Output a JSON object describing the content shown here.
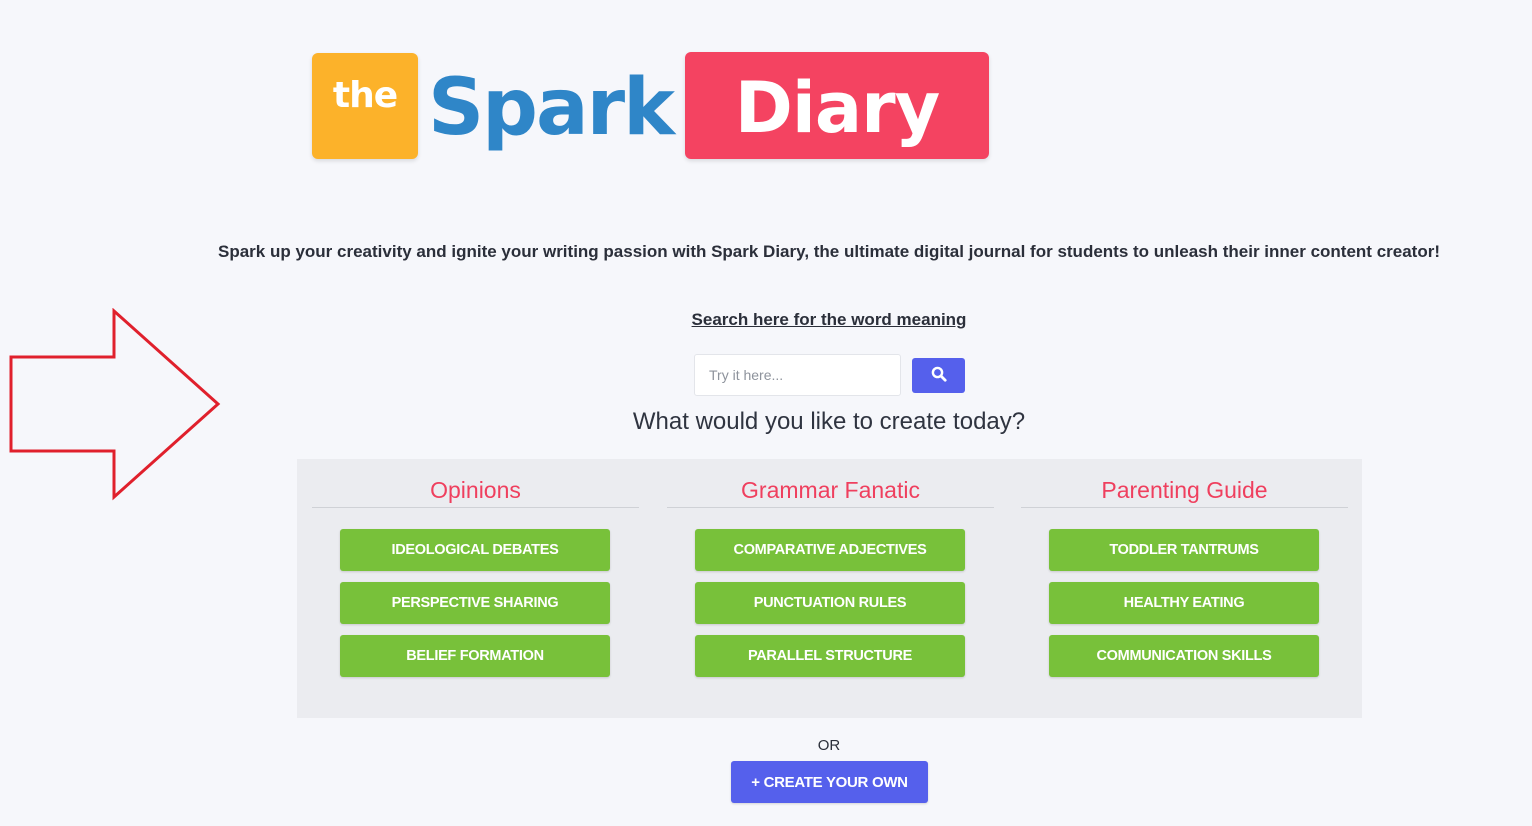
{
  "logo": {
    "the": "the",
    "spark": "Spark",
    "diary": "Diary"
  },
  "tagline": "Spark up your creativity and ignite your writing passion with Spark Diary, the ultimate digital journal for students to unleash their inner content creator!",
  "search": {
    "link_text": "Search here for the word meaning",
    "placeholder": "Try it here...",
    "value": "",
    "button_icon": "search-icon"
  },
  "prompt": "What would you like to create today?",
  "categories": [
    {
      "title": "Opinions",
      "items": [
        "IDEOLOGICAL DEBATES",
        "PERSPECTIVE SHARING",
        "BELIEF FORMATION"
      ]
    },
    {
      "title": "Grammar Fanatic",
      "items": [
        "COMPARATIVE ADJECTIVES",
        "PUNCTUATION RULES",
        "PARALLEL STRUCTURE"
      ]
    },
    {
      "title": "Parenting Guide",
      "items": [
        "TODDLER TANTRUMS",
        "HEALTHY EATING",
        "COMMUNICATION SKILLS"
      ]
    }
  ],
  "or_text": "OR",
  "create_button": "+ CREATE YOUR OWN",
  "colors": {
    "background": "#f6f7fb",
    "logo_the": "#fcb22a",
    "logo_spark": "#2f86c8",
    "logo_diary": "#f44361",
    "category_title": "#ef3f5e",
    "category_button": "#78c13a",
    "primary_button": "#5560ec",
    "annotation_arrow": "#e0202c"
  }
}
